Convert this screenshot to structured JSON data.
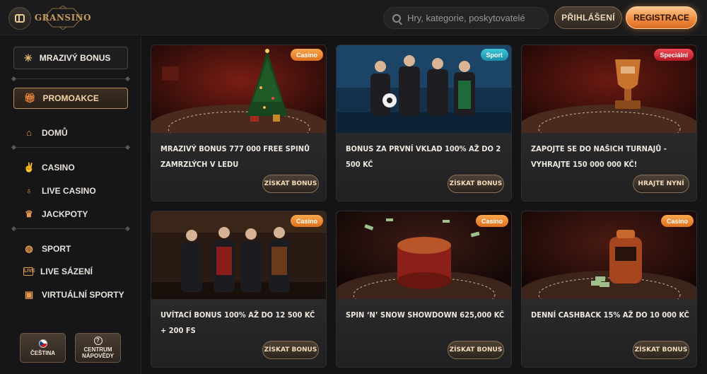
{
  "header": {
    "logo_text": "GRANSINO",
    "search_placeholder": "Hry, kategorie, poskytovatelé",
    "login_label": "PŘIHLÁŠENÍ",
    "register_label": "REGISTRACE"
  },
  "sidebar": {
    "frost_bonus": {
      "label": "MRAZIVÝ BONUS",
      "icon": "snowflake-icon"
    },
    "promo": {
      "label": "PROMOAKCE",
      "icon": "gift-icon"
    },
    "items": [
      {
        "label": "DOMŮ",
        "icon": "home-icon"
      },
      {
        "label": "CASINO",
        "icon": "casino-hand-icon"
      },
      {
        "label": "LIVE CASINO",
        "icon": "microphone-icon"
      },
      {
        "label": "JACKPOTY",
        "icon": "jackpot-icon"
      },
      {
        "label": "SPORT",
        "icon": "basketball-icon"
      },
      {
        "label": "LIVE SÁZENÍ",
        "icon": "live-icon"
      },
      {
        "label": "VIRTUÁLNÍ SPORTY",
        "icon": "virtual-sports-icon"
      }
    ],
    "language": {
      "label": "ČEŠTINA"
    },
    "help": {
      "line1": "CENTRUM",
      "line2": "NÁPOVĚDY"
    }
  },
  "promotions": [
    {
      "title": "MRAZIVÝ BONUS 777 000 FREE SPINŮ ZAMRZLÝCH V LEDU",
      "badge": "Casino",
      "badge_type": "casino",
      "cta": "ZÍSKAT BONUS"
    },
    {
      "title": "BONUS ZA PRVNÍ VKLAD 100% AŽ DO 2 500 KČ",
      "badge": "Sport",
      "badge_type": "sport",
      "cta": "ZÍSKAT BONUS"
    },
    {
      "title": "ZAPOJTE SE DO NAŠICH TURNAJŮ - VYHRAJTE 150 000 000 KČ!",
      "badge": "Speciální",
      "badge_type": "special",
      "cta": "HRAJTE NYNÍ"
    },
    {
      "title": "UVÍTACÍ BONUS 100% AŽ DO 12 500 KČ + 200 FS",
      "badge": "Casino",
      "badge_type": "casino",
      "cta": "ZÍSKAT BONUS"
    },
    {
      "title": "SPIN ‘N’ SNOW SHOWDOWN 625,000 KČ",
      "badge": "Casino",
      "badge_type": "casino",
      "cta": "ZÍSKAT BONUS"
    },
    {
      "title": "DENNÍ CASHBACK 15% AŽ DO 10 000 KČ",
      "badge": "Casino",
      "badge_type": "casino",
      "cta": "ZÍSKAT BONUS"
    }
  ],
  "colors": {
    "accent": "#f08a3c",
    "gold": "#c79b5c",
    "background": "#141416"
  }
}
